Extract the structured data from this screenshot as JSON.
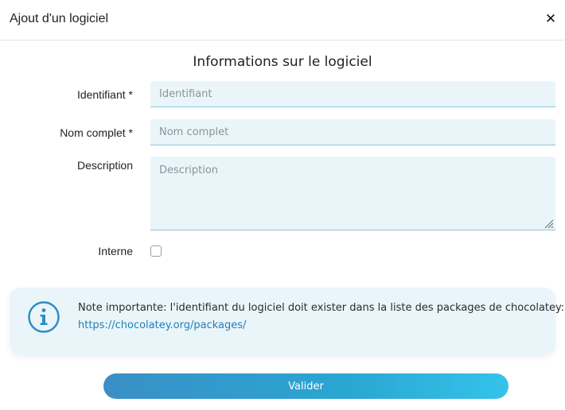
{
  "dialog": {
    "title": "Ajout d'un logiciel",
    "close_glyph": "✕",
    "close_icon": "close-icon"
  },
  "form": {
    "section_title": "Informations sur le logiciel",
    "identifier": {
      "label": "Identifiant *",
      "placeholder": "Identifiant",
      "value": ""
    },
    "full_name": {
      "label": "Nom complet *",
      "placeholder": "Nom complet",
      "value": ""
    },
    "description": {
      "label": "Description",
      "placeholder": "Description",
      "value": ""
    },
    "internal": {
      "label": "Interne",
      "checked": false
    }
  },
  "notice": {
    "icon": "info-icon",
    "text": "Note importante: l'identifiant du logiciel doit exister dans la liste des packages de chocolatey:",
    "link": "https://chocolatey.org/packages/"
  },
  "actions": {
    "submit_label": "Valider"
  },
  "colors": {
    "accent": "#2aa6d3",
    "field_bg": "#eaf5fa",
    "link": "#1f7eb8"
  }
}
